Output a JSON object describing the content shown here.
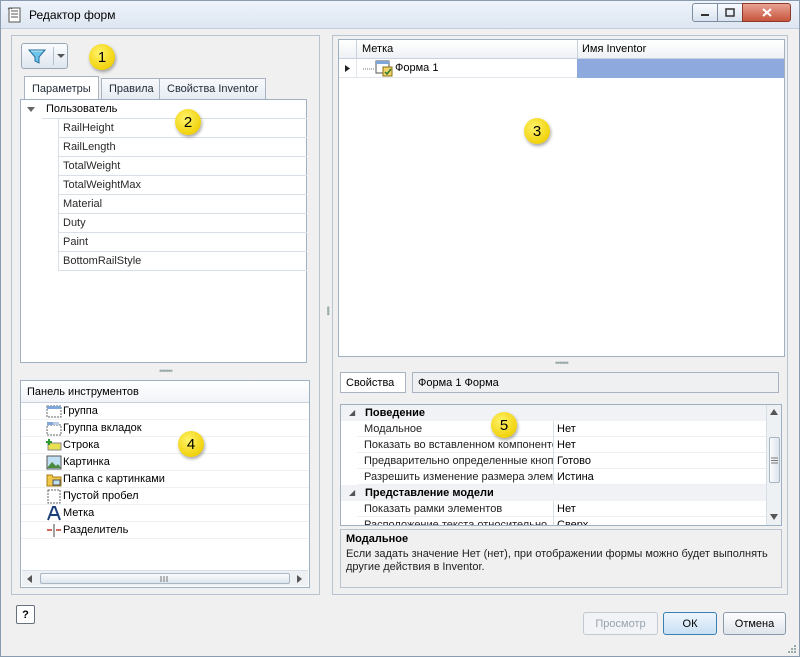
{
  "window": {
    "title": "Редактор форм",
    "controls": {
      "minimize": "–",
      "maximize": "□",
      "close": "✕"
    }
  },
  "callouts": [
    "1",
    "2",
    "3",
    "4",
    "5"
  ],
  "filter": {
    "icon": "filter-icon",
    "dropdown_icon": "dropdown-arrow-icon"
  },
  "tabs": [
    {
      "label": "Параметры",
      "active": true
    },
    {
      "label": "Правила",
      "active": false
    },
    {
      "label": "Свойства Inventor",
      "active": false
    }
  ],
  "parameters": {
    "group": "Пользователь",
    "items": [
      "RailHeight",
      "RailLength",
      "TotalWeight",
      "TotalWeightMax",
      "Material",
      "Duty",
      "Paint",
      "BottomRailStyle"
    ]
  },
  "toolbox": {
    "header": "Панель инструментов",
    "items": [
      "Группа",
      "Группа вкладок",
      "Строка",
      "Картинка",
      "Папка с картинками",
      "Пустой пробел",
      "Метка",
      "Разделитель"
    ]
  },
  "grid": {
    "columns": [
      "Метка",
      "Имя Inventor"
    ],
    "rows": [
      {
        "label": "Форма 1",
        "inventor_name": ""
      }
    ]
  },
  "properties": {
    "label": "Свойства",
    "object": "Форма 1 Форма",
    "categories": [
      {
        "name": "Поведение",
        "rows": [
          {
            "name": "Модальное",
            "value": "Нет"
          },
          {
            "name": "Показать во вставленном компоненте",
            "value": "Нет"
          },
          {
            "name": "Предварительно определенные кнопки",
            "value": "Готово"
          },
          {
            "name": "Разрешить изменение размера элементов",
            "value": "Истина"
          }
        ]
      },
      {
        "name": "Представление модели",
        "rows": [
          {
            "name": "Показать рамки элементов",
            "value": "Нет"
          },
          {
            "name": "Расположение текста относительно",
            "value": "Сверх"
          }
        ]
      }
    ],
    "description_title": "Модальное",
    "description": "Если задать значение Нет (нет), при отображении формы можно будет выполнять другие действия в Inventor."
  },
  "buttons": {
    "help": "?",
    "preview": "Просмотр",
    "ok": "ОК",
    "cancel": "Отмена"
  }
}
